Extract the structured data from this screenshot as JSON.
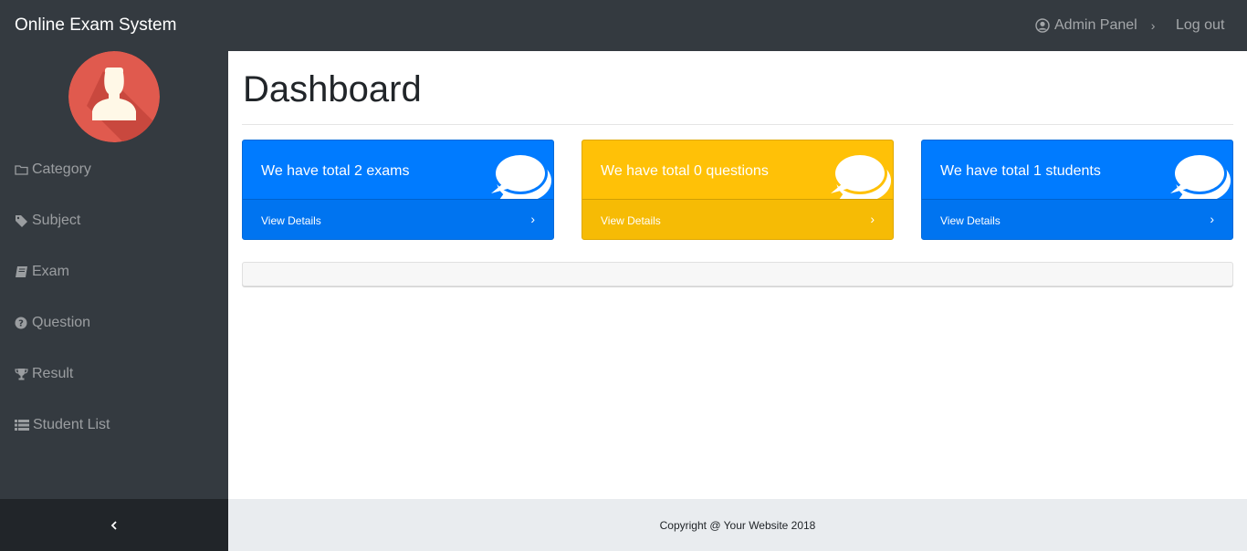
{
  "header": {
    "brand": "Online Exam System",
    "admin_label": "Admin Panel",
    "logout_label": "Log out"
  },
  "sidebar": {
    "items": [
      {
        "label": "Category",
        "icon": "folder-icon"
      },
      {
        "label": "Subject",
        "icon": "tag-icon"
      },
      {
        "label": "Exam",
        "icon": "book-icon"
      },
      {
        "label": "Question",
        "icon": "question-circle-icon"
      },
      {
        "label": "Result",
        "icon": "trophy-icon"
      },
      {
        "label": "Student List",
        "icon": "list-icon"
      }
    ]
  },
  "main": {
    "title": "Dashboard",
    "cards": [
      {
        "text": "We have total 2 exams",
        "link": "View Details",
        "color": "#007bff"
      },
      {
        "text": "We have total 0 questions",
        "link": "View Details",
        "color": "#ffc107"
      },
      {
        "text": "We have total 1 students",
        "link": "View Details",
        "color": "#007bff"
      }
    ]
  },
  "footer": {
    "copyright": "Copyright @ Your Website 2018"
  }
}
